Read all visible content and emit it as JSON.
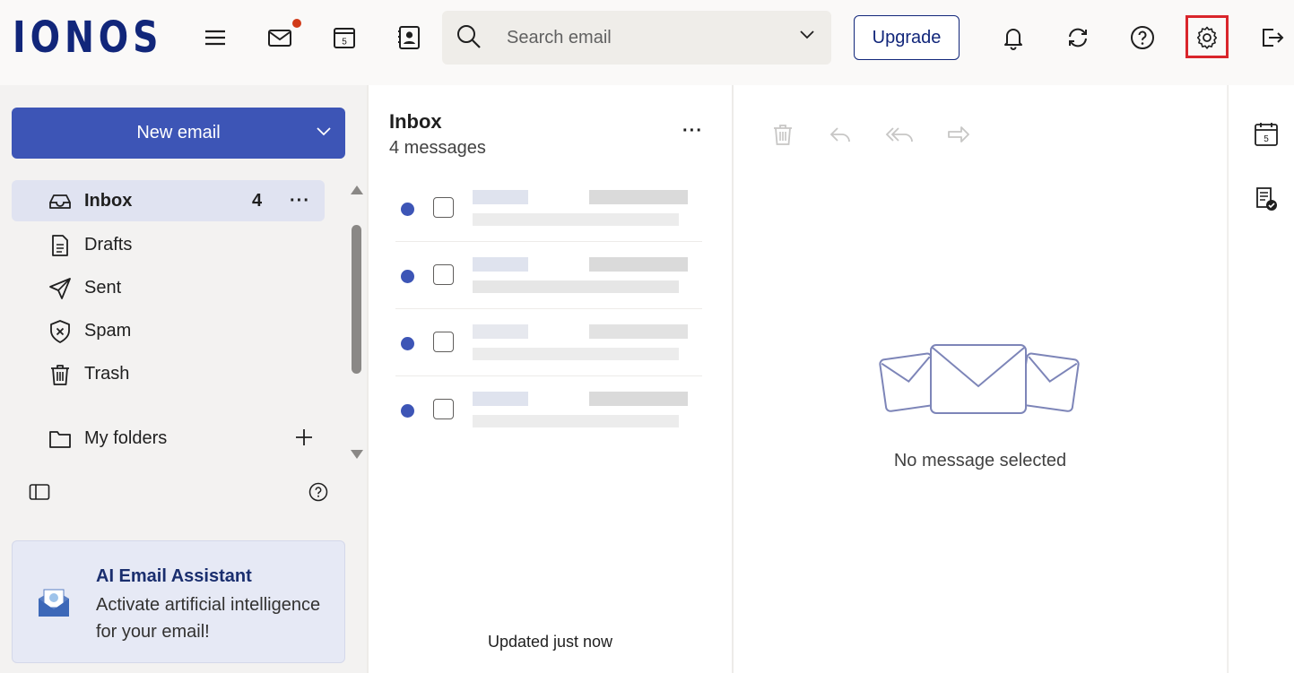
{
  "brand": {
    "logo_text": "IONOS",
    "color": "#11267a"
  },
  "topbar": {
    "icons": [
      "menu-icon",
      "mail-icon",
      "calendar-icon",
      "contacts-icon",
      "bell-icon",
      "sync-icon",
      "help-icon",
      "settings-icon",
      "logout-icon"
    ],
    "calendar_day": "5",
    "search_placeholder": "Search email",
    "upgrade_label": "Upgrade",
    "highlight_color": "#d9252b"
  },
  "sidebar": {
    "new_email_label": "New email",
    "folders": [
      {
        "label": "Inbox",
        "count": "4",
        "more": "···",
        "icon": "inbox-icon",
        "active": true
      },
      {
        "label": "Drafts",
        "icon": "drafts-icon"
      },
      {
        "label": "Sent",
        "icon": "sent-icon"
      },
      {
        "label": "Spam",
        "icon": "spam-icon"
      },
      {
        "label": "Trash",
        "icon": "trash-icon"
      }
    ],
    "my_folders_label": "My folders",
    "ai_card": {
      "title": "AI Email Assistant",
      "description": "Activate artificial intelligence for your email!"
    },
    "accent": "#3d55b6"
  },
  "message_list": {
    "title": "Inbox",
    "subtitle": "4 messages",
    "more": "···",
    "messages_count": 4,
    "updated_text": "Updated just now"
  },
  "reading_pane": {
    "toolbar_icons": [
      "delete-icon",
      "reply-icon",
      "reply-all-icon",
      "forward-icon"
    ],
    "empty_text": "No message selected"
  },
  "right_rail": {
    "icons": [
      "calendar-icon",
      "notes-icon"
    ],
    "calendar_day": "5"
  }
}
